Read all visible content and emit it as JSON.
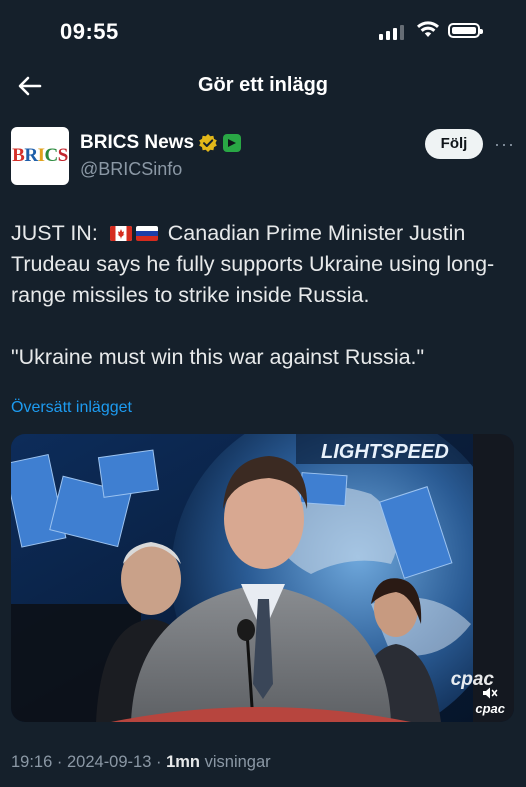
{
  "status_bar": {
    "time": "09:55"
  },
  "nav": {
    "title": "Gör ett inlägg"
  },
  "author": {
    "avatar_text": "BRICS",
    "display_name": "BRICS News",
    "handle": "@BRICSinfo",
    "follow_label": "Följ",
    "more_label": "···"
  },
  "tweet": {
    "line1_prefix": "JUST IN:",
    "line1_rest": "Canadian Prime Minister Justin Trudeau says he fully supports Ukraine using long-range missiles to strike inside Russia.",
    "quote": "\"Ukraine must win this war against Russia.\"",
    "flags": [
      "canada-flag-icon",
      "russia-flag-icon"
    ]
  },
  "translate_label": "Översätt inlägget",
  "media": {
    "banner_text": "LIGHTSPEED",
    "watermark": "cpac",
    "watermark_small": "cpac"
  },
  "meta": {
    "time": "19:16",
    "sep1": "·",
    "date": "2024-09-13",
    "sep2": "·",
    "views_count": "1mn",
    "views_label": "visningar"
  },
  "colors": {
    "background": "#15202b",
    "accent_link": "#1d9bf0",
    "muted_text": "#8b98a5",
    "verified_gold": "#e2b719",
    "follow_bg": "#eff3f4"
  }
}
